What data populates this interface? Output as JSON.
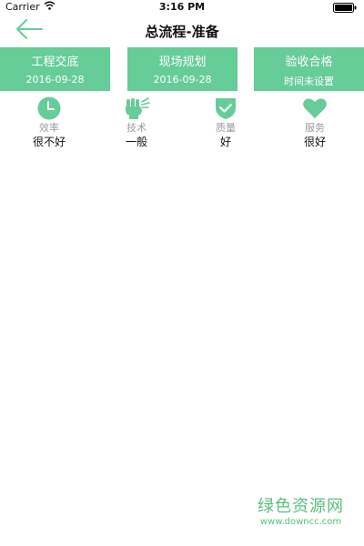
{
  "status_bar": {
    "carrier": "Carrier",
    "time": "3:16 PM",
    "wifi_icon": "wifi-icon",
    "battery_icon": "battery-icon"
  },
  "nav": {
    "title": "总流程-准备",
    "back_icon": "arrow-left-icon"
  },
  "steps": [
    {
      "title": "工程交底",
      "date": "2016-09-28"
    },
    {
      "title": "现场规划",
      "date": "2016-09-28"
    },
    {
      "title": "验收合格",
      "date": "时间未设置"
    }
  ],
  "ratings": [
    {
      "icon": "clock-icon",
      "label": "效率",
      "value": "很不好"
    },
    {
      "icon": "fist-icon",
      "label": "技术",
      "value": "一般"
    },
    {
      "icon": "shield-check-icon",
      "label": "质量",
      "value": "好"
    },
    {
      "icon": "heart-icon",
      "label": "服务",
      "value": "很好"
    }
  ],
  "colors": {
    "accent": "#66cc98",
    "label_gray": "#9a9a9a",
    "watermark": "#58c07a"
  },
  "watermark": {
    "logo_text": "绿色资源网",
    "url": "www.downcc.com"
  }
}
